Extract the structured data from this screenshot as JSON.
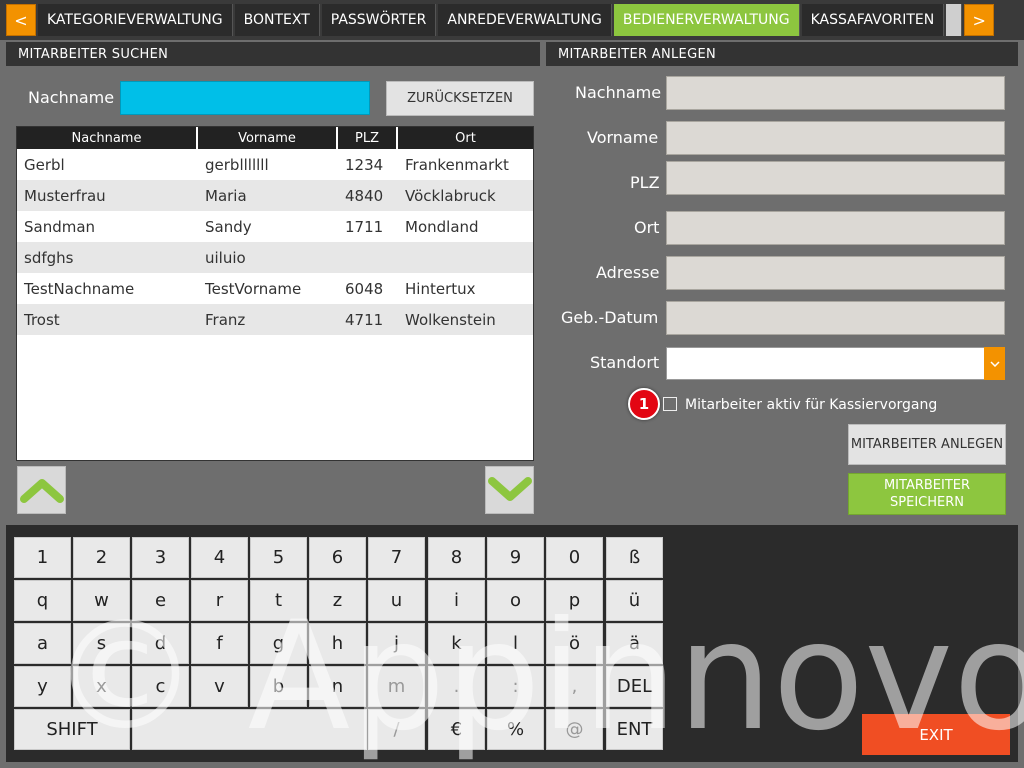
{
  "nav": {
    "prev": "<",
    "next": ">",
    "tabs": [
      "KATEGORIEVERWALTUNG",
      "BONTEXT",
      "PASSWÖRTER",
      "ANREDEVERWALTUNG",
      "BEDIENERVERWALTUNG",
      "KASSAFAVORITEN"
    ],
    "active_tab": "BEDIENERVERWALTUNG",
    "accent_color": "#8dc63f",
    "arrow_color": "#f39200"
  },
  "search": {
    "header": "MITARBEITER SUCHEN",
    "label": "Nachname",
    "value": "",
    "reset_label": "ZURÜCKSETZEN"
  },
  "table": {
    "columns": [
      "Nachname",
      "Vorname",
      "PLZ",
      "Ort"
    ],
    "rows": [
      [
        "Gerbl",
        "gerblllllll",
        "1234",
        "Frankenmarkt"
      ],
      [
        "Musterfrau",
        "Maria",
        "4840",
        "Vöcklabruck"
      ],
      [
        "Sandman",
        "Sandy",
        "1711",
        "Mondland"
      ],
      [
        "sdfghs",
        "uiluio",
        "",
        ""
      ],
      [
        "TestNachname",
        "TestVorname",
        "6048",
        "Hintertux"
      ],
      [
        "Trost",
        "Franz",
        "4711",
        "Wolkenstein"
      ]
    ]
  },
  "form": {
    "header": "MITARBEITER ANLEGEN",
    "fields": [
      "Nachname",
      "Vorname",
      "PLZ",
      "Ort",
      "Adresse",
      "Geb.-Datum"
    ],
    "standort_label": "Standort",
    "standort_value": "",
    "active_label": "Mitarbeiter aktiv für Kassiervorgang",
    "badge": "1",
    "create_label": "MITARBEITER ANLEGEN",
    "save_label": "MITARBEITER SPEICHERN"
  },
  "keyboard": {
    "row1": [
      "1",
      "2",
      "3",
      "4",
      "5",
      "6",
      "7",
      "8",
      "9",
      "0",
      "ß"
    ],
    "row2": [
      "q",
      "w",
      "e",
      "r",
      "t",
      "z",
      "u",
      "i",
      "o",
      "p",
      "ü"
    ],
    "row3": [
      "a",
      "s",
      "d",
      "f",
      "g",
      "h",
      "j",
      "k",
      "l",
      "ö",
      "ä"
    ],
    "row4": [
      "y",
      "x",
      "c",
      "v",
      "b",
      "n",
      "m",
      ".",
      ":",
      ",",
      "DEL"
    ],
    "shift": "SHIFT",
    "row5": [
      "/",
      "€",
      "%",
      "@",
      "ENT"
    ],
    "exit_label": "EXIT",
    "exit_color": "#f04e23"
  },
  "watermark": "© Appinnovo",
  "icons": {
    "scroll_up": "chevron-up-icon",
    "scroll_down": "chevron-down-icon",
    "dropdown": "chevron-down-icon"
  }
}
